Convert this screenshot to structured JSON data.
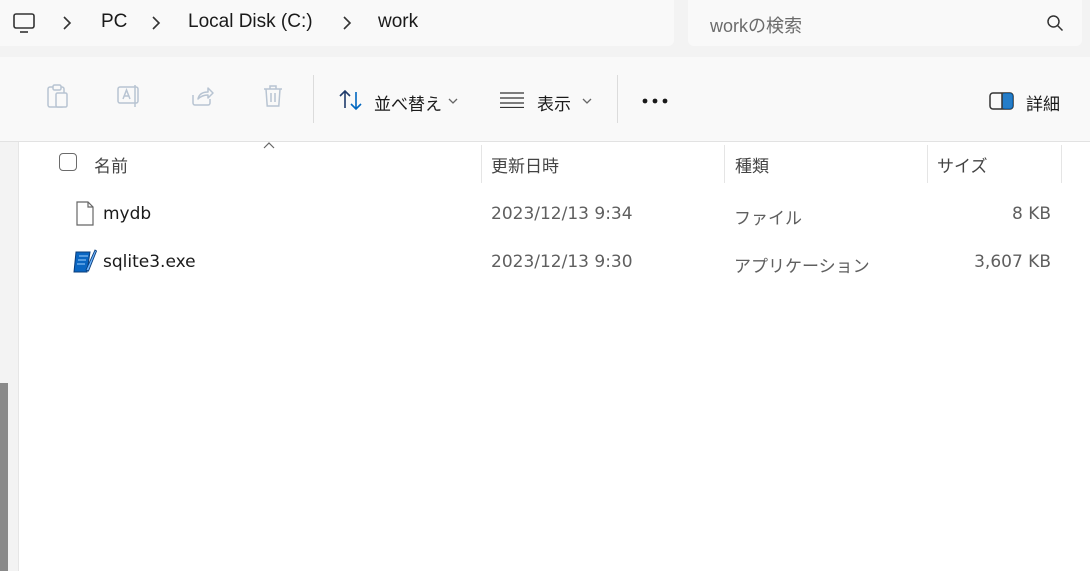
{
  "address_bar": {
    "computer_icon": "computer-icon",
    "crumbs": [
      "PC",
      "Local Disk (C:)",
      "work"
    ]
  },
  "search": {
    "placeholder": "workの検索",
    "icon": "search-icon"
  },
  "toolbar": {
    "sort_label": "並べ替え",
    "view_label": "表示",
    "more_label": "•••",
    "details_label": "詳細"
  },
  "columns": {
    "name": "名前",
    "modified": "更新日時",
    "type": "種類",
    "size": "サイズ"
  },
  "files": [
    {
      "name": "mydb",
      "modified": "2023/12/13 9:34",
      "type": "ファイル",
      "size": "8 KB",
      "icon": "file-icon"
    },
    {
      "name": "sqlite3.exe",
      "modified": "2023/12/13 9:30",
      "type": "アプリケーション",
      "size": "3,607 KB",
      "icon": "exe-icon"
    }
  ],
  "colors": {
    "accent": "#0067c0",
    "background": "#ffffff",
    "chrome": "#f3f3f3"
  }
}
